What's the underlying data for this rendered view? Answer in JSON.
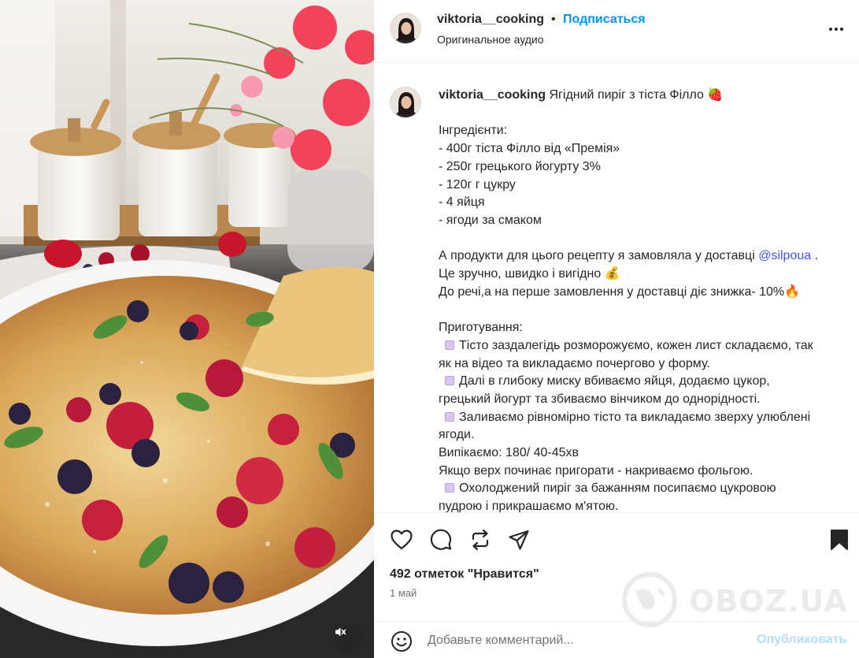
{
  "post": {
    "username": "viktoria__cooking",
    "dot": "•",
    "follow_label": "Подписаться",
    "audio_label": "Оригинальное аудио",
    "caption_title": "Ягідний пиріг з тіста Філло 🍓",
    "caption_lines": [
      "",
      "Інгредієнти:",
      "- 400г тіста Філло від «Премія»",
      "- 250г грецького йогурту 3%",
      "- 120г г цукру",
      "- 4 яйця",
      "- ягоди за смаком",
      "",
      "",
      "Це зручно, швидко і вигідно 💰",
      "До речі,а на перше замовлення у доставці діє знижка- 10%🔥",
      "",
      "Приготування:"
    ],
    "promo_line_before": "А продукти для цього рецепту я замовляла у доставці ",
    "promo_mention": "@silpoua",
    "promo_line_after": " .",
    "steps": [
      "Тісто заздалегідь розморожуємо, кожен лист складаємо, так",
      "як на відео та викладаємо почергово у форму.",
      "Далі в глибоку миску вбиваємо яйця, додаємо цукор,",
      "грецький йогурт та збиваємо вінчиком до однорідності.",
      "Заливаємо рівномірно тісто та викладаємо зверху улюблені",
      "ягоди.",
      "Випікаємо: 180/ 40-45хв",
      "Якщо верх починає пригорати - накриваємо фольгою.",
      "Охолоджений пиріг за бажанням посипаємо цукровою",
      "пудрою і прикрашаємо м'ятою."
    ],
    "likes_text": "492 отметок \"Нравится\"",
    "date_text": "1 май"
  },
  "actions": {
    "like_icon": "heart-icon",
    "comment_icon": "comment-icon",
    "share_icon": "repost-icon",
    "send_icon": "send-icon",
    "save_icon": "bookmark-icon"
  },
  "comment": {
    "placeholder": "Добавьте комментарий...",
    "post_label": "Опубликовать"
  },
  "watermark": {
    "text": "OBOZ.UA"
  },
  "colors": {
    "accent": "#0095f6",
    "mention": "#4150f7",
    "post_disabled": "#b2dffc",
    "muted": "#737373"
  }
}
